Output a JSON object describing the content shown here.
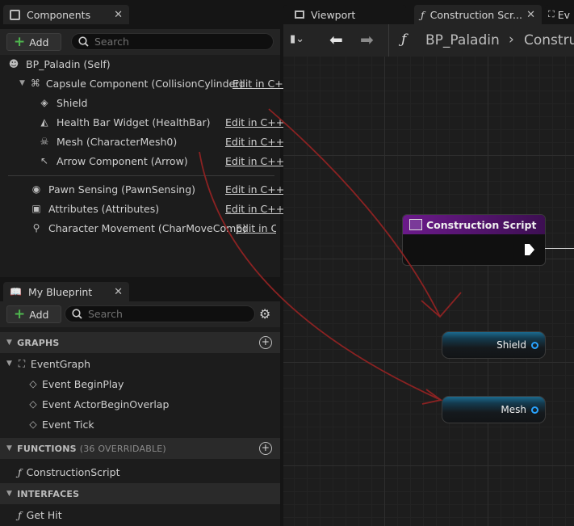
{
  "components": {
    "tab_title": "Components",
    "add_label": "Add",
    "search_placeholder": "Search",
    "root": "BP_Paladin (Self)",
    "items": [
      {
        "label": "Capsule Component (CollisionCylinder)",
        "edit": "Edit in C++"
      },
      {
        "label": "Shield",
        "edit": ""
      },
      {
        "label": "Health Bar Widget (HealthBar)",
        "edit": "Edit in C++"
      },
      {
        "label": "Mesh (CharacterMesh0)",
        "edit": "Edit in C++"
      },
      {
        "label": "Arrow Component (Arrow)",
        "edit": "Edit in C++"
      },
      {
        "label": "Pawn Sensing (PawnSensing)",
        "edit": "Edit in C++"
      },
      {
        "label": "Attributes (Attributes)",
        "edit": "Edit in C++"
      },
      {
        "label": "Character Movement (CharMoveComp)",
        "edit": "Edit in C++"
      }
    ]
  },
  "my_blueprint": {
    "tab_title": "My Blueprint",
    "add_label": "Add",
    "search_placeholder": "Search",
    "graphs_header": "GRAPHS",
    "event_graph": "EventGraph",
    "events": [
      "Event BeginPlay",
      "Event ActorBeginOverlap",
      "Event Tick"
    ],
    "functions_header": "FUNCTIONS",
    "functions_sub": "(36 OVERRIDABLE)",
    "construction_script": "ConstructionScript",
    "interfaces_header": "INTERFACES",
    "get_hit": "Get Hit"
  },
  "editor": {
    "tab_viewport": "Viewport",
    "tab_construction": "Construction Scr...",
    "tab_partial": "Ev",
    "breadcrumb_root": "BP_Paladin",
    "breadcrumb_current": "Constru",
    "node_title": "Construction Script",
    "node_shield": "Shield",
    "node_mesh": "Mesh"
  },
  "colors": {
    "accent_green": "#4fb84f",
    "function_purple": "#6b1a8a",
    "pin_blue": "#29a4ff",
    "annotation_red": "#8b2222"
  }
}
